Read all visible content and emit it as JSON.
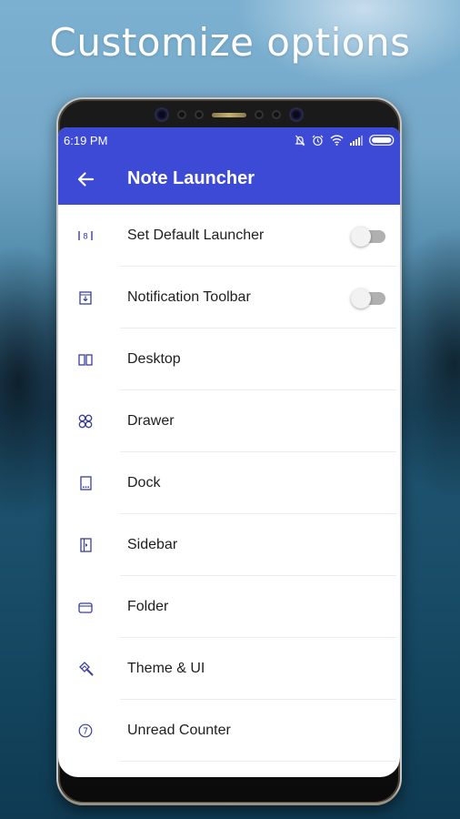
{
  "promo": {
    "headline": "Customize options"
  },
  "status_bar": {
    "time": "6:19 PM",
    "icons": [
      "silent-bell-icon",
      "alarm-icon",
      "wifi-icon",
      "signal-icon",
      "battery-icon"
    ]
  },
  "app_bar": {
    "back_icon": "arrow-left-icon",
    "title": "Note Launcher",
    "color": "#3c4ad6"
  },
  "settings": {
    "items": [
      {
        "label": "Set Default Launcher",
        "icon": "default-launcher-icon",
        "toggle": true,
        "toggle_on": false
      },
      {
        "label": "Notification Toolbar",
        "icon": "notification-toolbar-icon",
        "toggle": true,
        "toggle_on": false
      },
      {
        "label": "Desktop",
        "icon": "desktop-icon",
        "toggle": false
      },
      {
        "label": "Drawer",
        "icon": "drawer-icon",
        "toggle": false
      },
      {
        "label": "Dock",
        "icon": "dock-icon",
        "toggle": false
      },
      {
        "label": "Sidebar",
        "icon": "sidebar-icon",
        "toggle": false
      },
      {
        "label": "Folder",
        "icon": "folder-icon",
        "toggle": false
      },
      {
        "label": "Theme & UI",
        "icon": "theme-brush-icon",
        "toggle": false
      },
      {
        "label": "Unread Counter",
        "icon": "unread-counter-icon",
        "toggle": false
      }
    ],
    "icon_color": "#3a3f9a"
  }
}
